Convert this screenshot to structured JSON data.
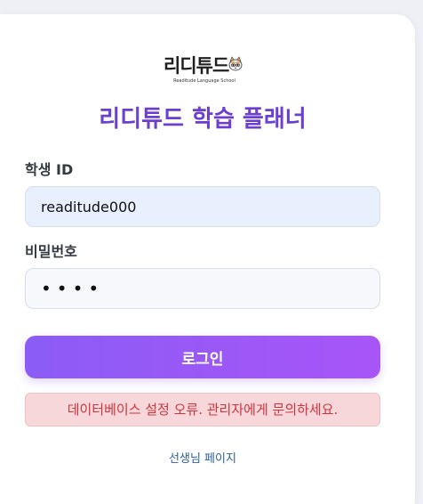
{
  "logo": {
    "text": "리디튜드",
    "subtitle": "Readitude Language School",
    "mascot_icon": "cat-mascot-icon"
  },
  "title": "리디튜드 학습 플래너",
  "form": {
    "student_id_label": "학생 ID",
    "student_id_value": "readitude000",
    "password_label": "비밀번호",
    "password_masked": "••••",
    "login_label": "로그인"
  },
  "error_message": "데이터베이스 설정 오류. 관리자에게 문의하세요.",
  "teacher_link": "선생님 페이지",
  "colors": {
    "accent": "#6b3fd1",
    "button_start": "#8b5cf6",
    "button_end": "#a855f7",
    "error_bg": "#f8d7da",
    "error_text": "#d0343e",
    "link": "#2b5fa8"
  }
}
